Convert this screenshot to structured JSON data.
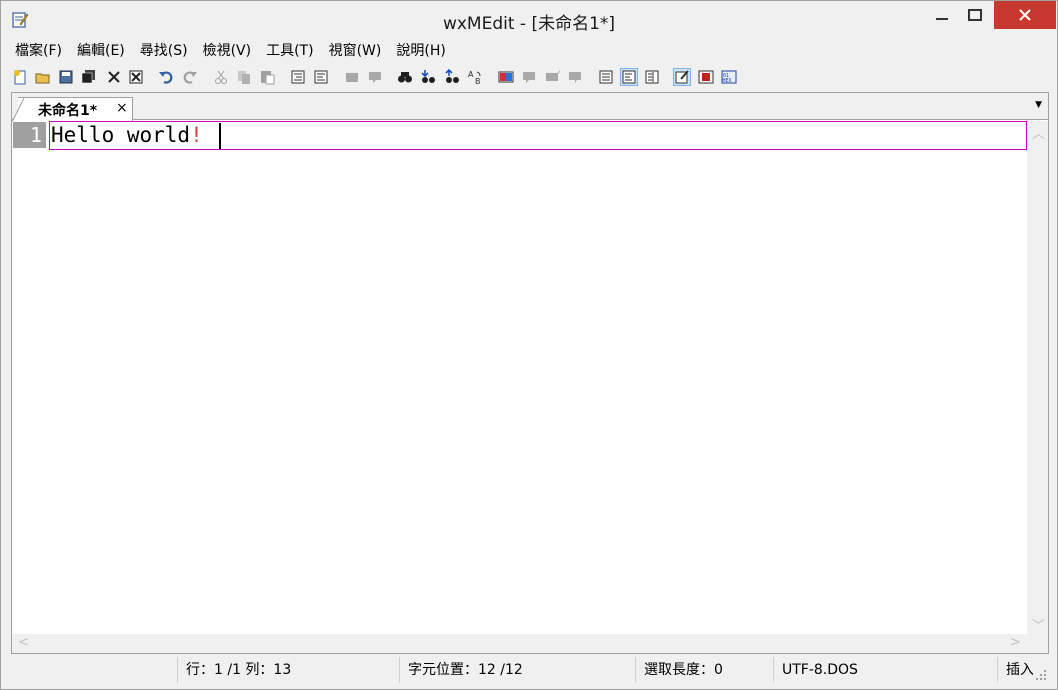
{
  "window": {
    "title": "wxMEdit - [未命名1*]"
  },
  "menu": [
    {
      "label": "檔案(F)"
    },
    {
      "label": "編輯(E)"
    },
    {
      "label": "尋找(S)"
    },
    {
      "label": "檢視(V)"
    },
    {
      "label": "工具(T)"
    },
    {
      "label": "視窗(W)"
    },
    {
      "label": "說明(H)"
    }
  ],
  "toolbar_icons": [
    "new-file-icon",
    "open-file-icon",
    "save-icon",
    "save-all-icon",
    "close-icon",
    "close-all-icon",
    "undo-icon",
    "redo-icon",
    "cut-icon",
    "copy-icon",
    "paste-icon",
    "indent-icon",
    "unindent-icon",
    "comment-icon",
    "uncomment-icon",
    "find-icon",
    "find-next-icon",
    "find-previous-icon",
    "replace-icon",
    "text-mode-icon",
    "column-mode-icon",
    "hex-mode-icon",
    "word-wrap-icon",
    "no-wrap-icon",
    "wrap-by-window-icon",
    "wrap-by-column-icon",
    "spell-icon",
    "mark-icon",
    "hex-view-icon"
  ],
  "tab": {
    "label": "未命名1*",
    "close": "×"
  },
  "editor": {
    "line_number": "1",
    "text_main": "Hello world",
    "text_punc": "!"
  },
  "statusbar": {
    "line": "行：1 /1 列：13",
    "char_pos": "字元位置：12 /12",
    "sel_len": "選取長度：0",
    "encoding": "UTF-8.DOS",
    "mode": "插入"
  },
  "colors": {
    "close_button": "#c7392f",
    "current_line_border": "#cc00cc",
    "gutter": "#a0a0a0",
    "punctuation": "#cc4444"
  }
}
